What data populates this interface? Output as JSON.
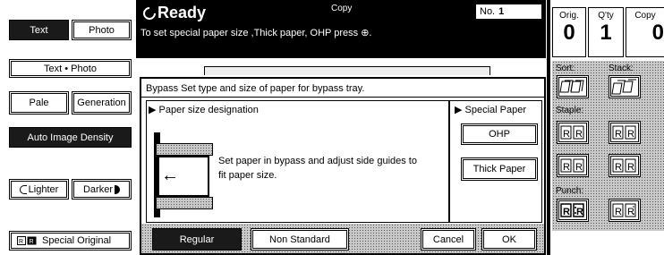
{
  "left_panel": {
    "text_label": "Text",
    "photo_label": "Photo",
    "text_photo_label": "Text • Photo",
    "pale_label": "Pale",
    "generation_label": "Generation",
    "auto_density_label": "Auto Image Density",
    "lighter_label": "Lighter",
    "darker_label": "Darker",
    "special_original_label": "Special Original"
  },
  "header": {
    "status": "Ready",
    "mode": "Copy",
    "message": "To set special paper size ,Thick paper, OHP press ⊕.",
    "no_label": "No.",
    "no_value": "1"
  },
  "dialog": {
    "title": "Bypass   Set type and size of paper for bypass tray.",
    "section_left": "Paper size designation",
    "instruction_line1": "Set paper in bypass and adjust side guides to",
    "instruction_line2": "fit paper size.",
    "section_right": "Special Paper",
    "ohp_label": "OHP",
    "thick_paper_label": "Thick Paper",
    "regular_label": "Regular",
    "non_standard_label": "Non Standard",
    "cancel_label": "Cancel",
    "ok_label": "OK"
  },
  "right_panel": {
    "orig_label": "Orig.",
    "qty_label": "Q'ty",
    "copy_label": "Copy",
    "orig_value": "0",
    "qty_value": "1",
    "copy_value": "0",
    "sort_label": "Sort:",
    "stack_label": "Stack:",
    "staple_label": "Staple:",
    "punch_label": "Punch:"
  }
}
